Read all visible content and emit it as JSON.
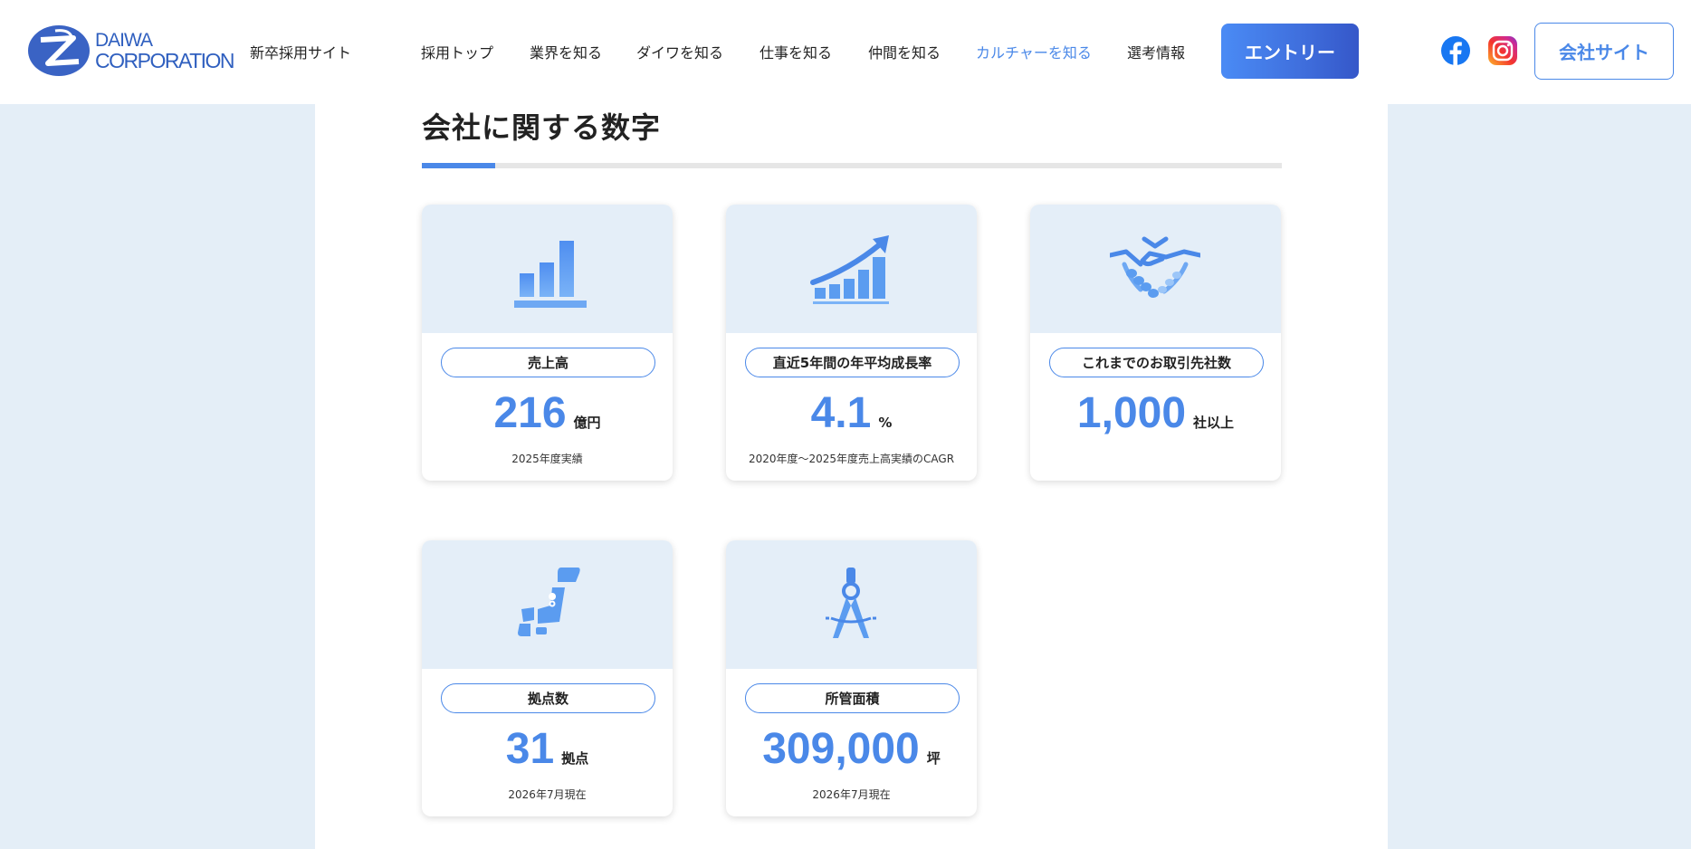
{
  "header": {
    "logo": {
      "line1": "DAIWA",
      "line2": "CORPORATION"
    },
    "site_label": "新卒採用サイト",
    "nav": [
      {
        "label": "採用トップ",
        "active": false
      },
      {
        "label": "業界を知る",
        "active": false
      },
      {
        "label": "ダイワを知る",
        "active": false
      },
      {
        "label": "仕事を知る",
        "active": false
      },
      {
        "label": "仲間を知る",
        "active": false
      },
      {
        "label": "カルチャーを知る",
        "active": true
      },
      {
        "label": "選考情報",
        "active": false
      }
    ],
    "entry_button": "エントリー",
    "social": [
      "facebook-icon",
      "instagram-icon"
    ],
    "corporate_button": "会社サイト"
  },
  "section": {
    "title": "会社に関する数字"
  },
  "cards": [
    {
      "icon": "bar-chart-icon",
      "label": "売上高",
      "value": "216",
      "unit": "億円",
      "note": "2025年度実績"
    },
    {
      "icon": "growth-chart-icon",
      "label": "直近5年間の年平均成長率",
      "value": "4.1",
      "unit": "%",
      "note": "2020年度～2025年度売上高実績のCAGR"
    },
    {
      "icon": "handshake-icon",
      "label": "これまでのお取引先社数",
      "value": "1,000",
      "unit": "社以上",
      "note": ""
    },
    {
      "icon": "japan-map-icon",
      "label": "拠点数",
      "value": "31",
      "unit": "拠点",
      "note": "2026年7月現在"
    },
    {
      "icon": "compass-icon",
      "label": "所管面積",
      "value": "309,000",
      "unit": "坪",
      "note": "2026年7月現在"
    }
  ],
  "colors": {
    "accent": "#4a88e8",
    "page_background": "#e4eef7",
    "card_top": "#e4eef8",
    "icon": "#5b9cf0"
  }
}
